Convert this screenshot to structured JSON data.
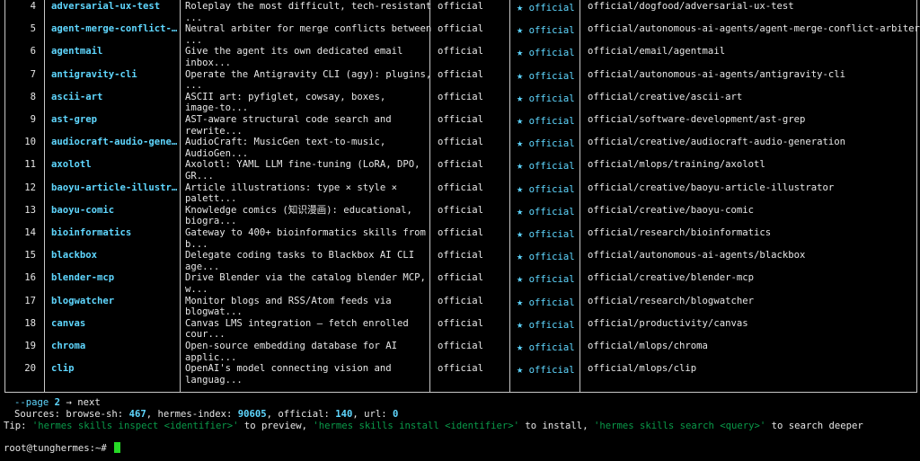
{
  "rows": [
    {
      "num": "4",
      "name": "adversarial-ux-test",
      "desc1": "Roleplay the most difficult, tech-resistant",
      "desc2": "...",
      "source": "official",
      "trust": "official",
      "identifier": "official/dogfood/adversarial-ux-test"
    },
    {
      "num": "5",
      "name": "agent-merge-conflict-…",
      "desc1": "Neutral arbiter for merge conflicts between",
      "desc2": "...",
      "source": "official",
      "trust": "official",
      "identifier": "official/autonomous-ai-agents/agent-merge-conflict-arbiter"
    },
    {
      "num": "6",
      "name": "agentmail",
      "desc1": "Give the agent its own dedicated email",
      "desc2": "inbox...",
      "source": "official",
      "trust": "official",
      "identifier": "official/email/agentmail"
    },
    {
      "num": "7",
      "name": "antigravity-cli",
      "desc1": "Operate the Antigravity CLI (agy): plugins,",
      "desc2": "...",
      "source": "official",
      "trust": "official",
      "identifier": "official/autonomous-ai-agents/antigravity-cli"
    },
    {
      "num": "8",
      "name": "ascii-art",
      "desc1": "ASCII art: pyfiglet, cowsay, boxes,",
      "desc2": "image-to...",
      "source": "official",
      "trust": "official",
      "identifier": "official/creative/ascii-art"
    },
    {
      "num": "9",
      "name": "ast-grep",
      "desc1": "AST-aware structural code search and",
      "desc2": "rewrite...",
      "source": "official",
      "trust": "official",
      "identifier": "official/software-development/ast-grep"
    },
    {
      "num": "10",
      "name": "audiocraft-audio-gene…",
      "desc1": "AudioCraft: MusicGen text-to-music,",
      "desc2": "AudioGen...",
      "source": "official",
      "trust": "official",
      "identifier": "official/creative/audiocraft-audio-generation"
    },
    {
      "num": "11",
      "name": "axolotl",
      "desc1": "Axolotl: YAML LLM fine-tuning (LoRA, DPO,",
      "desc2": "GR...",
      "source": "official",
      "trust": "official",
      "identifier": "official/mlops/training/axolotl"
    },
    {
      "num": "12",
      "name": "baoyu-article-illustr…",
      "desc1": "Article illustrations: type × style ×",
      "desc2": "palett...",
      "source": "official",
      "trust": "official",
      "identifier": "official/creative/baoyu-article-illustrator"
    },
    {
      "num": "13",
      "name": "baoyu-comic",
      "desc1": "Knowledge comics (知识漫画): educational,",
      "desc2": "biogra...",
      "source": "official",
      "trust": "official",
      "identifier": "official/creative/baoyu-comic"
    },
    {
      "num": "14",
      "name": "bioinformatics",
      "desc1": "Gateway to 400+ bioinformatics skills from",
      "desc2": "b...",
      "source": "official",
      "trust": "official",
      "identifier": "official/research/bioinformatics"
    },
    {
      "num": "15",
      "name": "blackbox",
      "desc1": "Delegate coding tasks to Blackbox AI CLI",
      "desc2": "age...",
      "source": "official",
      "trust": "official",
      "identifier": "official/autonomous-ai-agents/blackbox"
    },
    {
      "num": "16",
      "name": "blender-mcp",
      "desc1": "Drive Blender via the catalog blender MCP,",
      "desc2": "w...",
      "source": "official",
      "trust": "official",
      "identifier": "official/creative/blender-mcp"
    },
    {
      "num": "17",
      "name": "blogwatcher",
      "desc1": "Monitor blogs and RSS/Atom feeds via",
      "desc2": "blogwat...",
      "source": "official",
      "trust": "official",
      "identifier": "official/research/blogwatcher"
    },
    {
      "num": "18",
      "name": "canvas",
      "desc1": "Canvas LMS integration — fetch enrolled",
      "desc2": "cour...",
      "source": "official",
      "trust": "official",
      "identifier": "official/productivity/canvas"
    },
    {
      "num": "19",
      "name": "chroma",
      "desc1": "Open-source embedding database for AI",
      "desc2": "applic...",
      "source": "official",
      "trust": "official",
      "identifier": "official/mlops/chroma"
    },
    {
      "num": "20",
      "name": "clip",
      "desc1": "OpenAI's model connecting vision and",
      "desc2": "languag...",
      "source": "official",
      "trust": "official",
      "identifier": "official/mlops/clip"
    }
  ],
  "trust_icon": "star-icon",
  "footer": {
    "page_flag": "--page",
    "page_num": "2",
    "page_next": "→ next",
    "sources_label": "Sources: browse-sh:",
    "browse_sh": "467",
    "hermes_index_label": ", hermes-index:",
    "hermes_index": "90605",
    "official_label": ", official:",
    "official": "140",
    "url_label": ", url:",
    "url": "0",
    "tip_prefix": "Tip: ",
    "tip_cmd1": "'hermes skills inspect <identifier>'",
    "tip_mid1": " to preview, ",
    "tip_cmd2": "'hermes skills install <identifier>'",
    "tip_mid2": " to install, ",
    "tip_cmd3": "'hermes skills search <query>'",
    "tip_suffix": " to search deeper",
    "prompt": "root@tunghermes:~# "
  },
  "colors": {
    "accent": "#5fd7ff",
    "tip_command": "#0a9a4a",
    "cursor": "#26d926",
    "background": "#000000"
  }
}
